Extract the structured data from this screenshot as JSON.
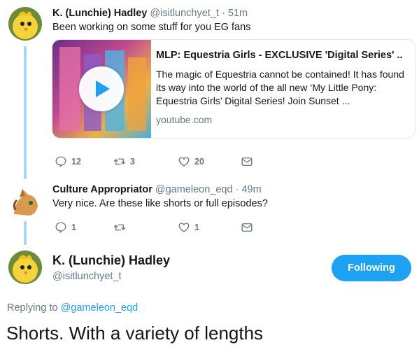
{
  "tweets": [
    {
      "name": "K. (Lunchie) Hadley",
      "handle": "@isitlunchyet_t",
      "time": "· 51m",
      "text": "Been working on some stuff for you EG fans",
      "card": {
        "title": "MLP: Equestria Girls - EXCLUSIVE 'Digital Series' ..",
        "description": "The magic of Equestria cannot be contained! It has found its way into the world of the all new ‘My Little Pony: Equestria Girls’ Digital Series! Join Sunset ...",
        "domain": "youtube.com"
      },
      "actions": {
        "replies": "12",
        "retweets": "3",
        "likes": "20"
      }
    },
    {
      "name": "Culture Appropriator",
      "handle": "@gameleon_eqd",
      "time": "· 49m",
      "text": "Very nice. Are these like shorts or full episodes?",
      "actions": {
        "replies": "1",
        "retweets": "",
        "likes": "1"
      }
    }
  ],
  "main_tweet": {
    "name": "K. (Lunchie) Hadley",
    "handle": "@isitlunchyet_t",
    "follow_label": "Following",
    "replying_prefix": "Replying to",
    "replying_to": "@gameleon_eqd",
    "text": "Shorts. With a variety of lengths"
  },
  "colors": {
    "accent": "#1da1f2",
    "thread_line": "#a8d5f5",
    "muted": "#657786"
  },
  "icons": [
    "reply-icon",
    "retweet-icon",
    "like-icon",
    "dm-icon",
    "play-icon"
  ]
}
